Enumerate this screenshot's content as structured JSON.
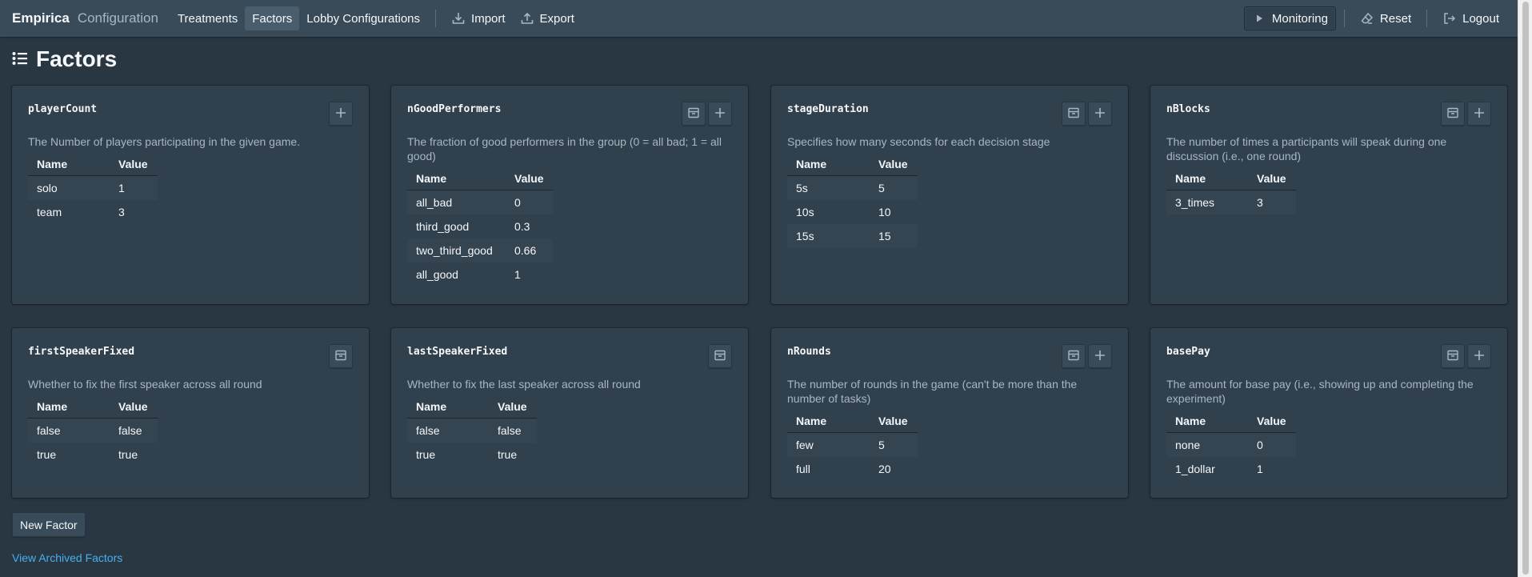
{
  "nav": {
    "brand": "Empirica",
    "brand_sub": "Configuration",
    "items": [
      {
        "label": "Treatments",
        "active": false
      },
      {
        "label": "Factors",
        "active": true
      },
      {
        "label": "Lobby Configurations",
        "active": false
      }
    ],
    "import_label": "Import",
    "export_label": "Export",
    "monitoring_label": "Monitoring",
    "reset_label": "Reset",
    "logout_label": "Logout"
  },
  "page": {
    "title": "Factors"
  },
  "cards": [
    {
      "name": "playerCount",
      "description": "The Number of players participating in the given game.",
      "has_archive": false,
      "has_add": true,
      "col_name": "Name",
      "col_value": "Value",
      "rows": [
        {
          "name": "solo",
          "value": "1"
        },
        {
          "name": "team",
          "value": "3"
        }
      ]
    },
    {
      "name": "nGoodPerformers",
      "description": "The fraction of good performers in the group (0 = all bad; 1 = all good)",
      "has_archive": true,
      "has_add": true,
      "col_name": "Name",
      "col_value": "Value",
      "rows": [
        {
          "name": "all_bad",
          "value": "0"
        },
        {
          "name": "third_good",
          "value": "0.3"
        },
        {
          "name": "two_third_good",
          "value": "0.66"
        },
        {
          "name": "all_good",
          "value": "1"
        }
      ]
    },
    {
      "name": "stageDuration",
      "description": "Specifies how many seconds for each decision stage",
      "has_archive": true,
      "has_add": true,
      "col_name": "Name",
      "col_value": "Value",
      "rows": [
        {
          "name": "5s",
          "value": "5"
        },
        {
          "name": "10s",
          "value": "10"
        },
        {
          "name": "15s",
          "value": "15"
        }
      ]
    },
    {
      "name": "nBlocks",
      "description": "The number of times a participants will speak during one discussion (i.e., one round)",
      "has_archive": true,
      "has_add": true,
      "col_name": "Name",
      "col_value": "Value",
      "rows": [
        {
          "name": "3_times",
          "value": "3"
        }
      ]
    },
    {
      "name": "firstSpeakerFixed",
      "description": "Whether to fix the first speaker across all round",
      "has_archive": true,
      "has_add": false,
      "col_name": "Name",
      "col_value": "Value",
      "rows": [
        {
          "name": "false",
          "value": "false"
        },
        {
          "name": "true",
          "value": "true"
        }
      ]
    },
    {
      "name": "lastSpeakerFixed",
      "description": "Whether to fix the last speaker across all round",
      "has_archive": true,
      "has_add": false,
      "col_name": "Name",
      "col_value": "Value",
      "rows": [
        {
          "name": "false",
          "value": "false"
        },
        {
          "name": "true",
          "value": "true"
        }
      ]
    },
    {
      "name": "nRounds",
      "description": "The number of rounds in the game (can't be more than the number of tasks)",
      "has_archive": true,
      "has_add": true,
      "col_name": "Name",
      "col_value": "Value",
      "rows": [
        {
          "name": "few",
          "value": "5"
        },
        {
          "name": "full",
          "value": "20"
        }
      ]
    },
    {
      "name": "basePay",
      "description": "The amount for base pay (i.e., showing up and completing the experiment)",
      "has_archive": true,
      "has_add": true,
      "col_name": "Name",
      "col_value": "Value",
      "rows": [
        {
          "name": "none",
          "value": "0"
        },
        {
          "name": "1_dollar",
          "value": "1"
        }
      ]
    }
  ],
  "footer": {
    "new_factor_label": "New Factor",
    "archived_link": "View Archived Factors"
  }
}
